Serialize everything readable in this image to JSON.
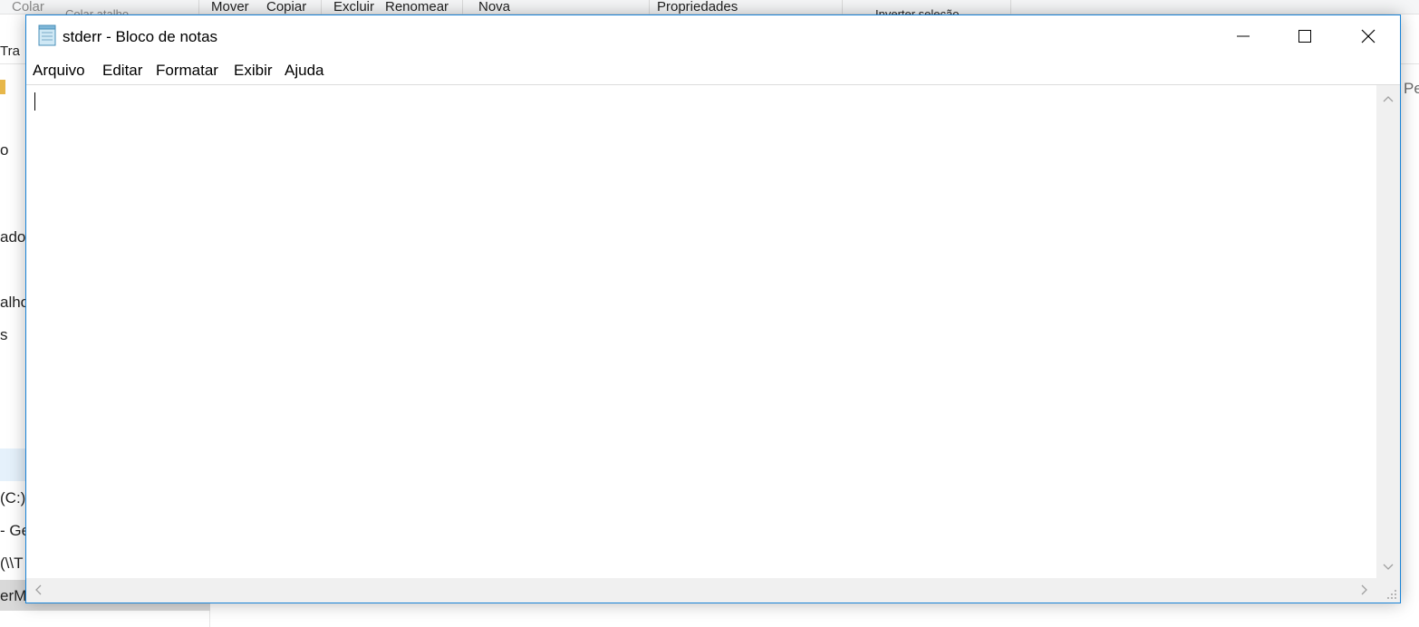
{
  "background_window": {
    "ribbon": {
      "colar": "Colar",
      "colar_atalho": "Colar atalho",
      "mover": "Mover",
      "copiar": "Copiar",
      "excluir": "Excluir",
      "renomear": "Renomear",
      "nova": "Nova",
      "propriedades": "Propriedades",
      "inverter_selecao": "Inverter seleção"
    },
    "tra_label": "Tra",
    "search_fragment": "Pe",
    "sidebar_fragments": [
      "o",
      "ador",
      "alho",
      "s",
      "(C:)",
      "- Ge",
      "(\\\\T",
      "erM"
    ]
  },
  "notepad": {
    "title": "stderr - Bloco de notas",
    "menu": [
      "Arquivo",
      "Editar",
      "Formatar",
      "Exibir",
      "Ajuda"
    ],
    "content": ""
  },
  "colors": {
    "accent_border": "#1883d7",
    "scrollbar": "#f0f0f0"
  }
}
